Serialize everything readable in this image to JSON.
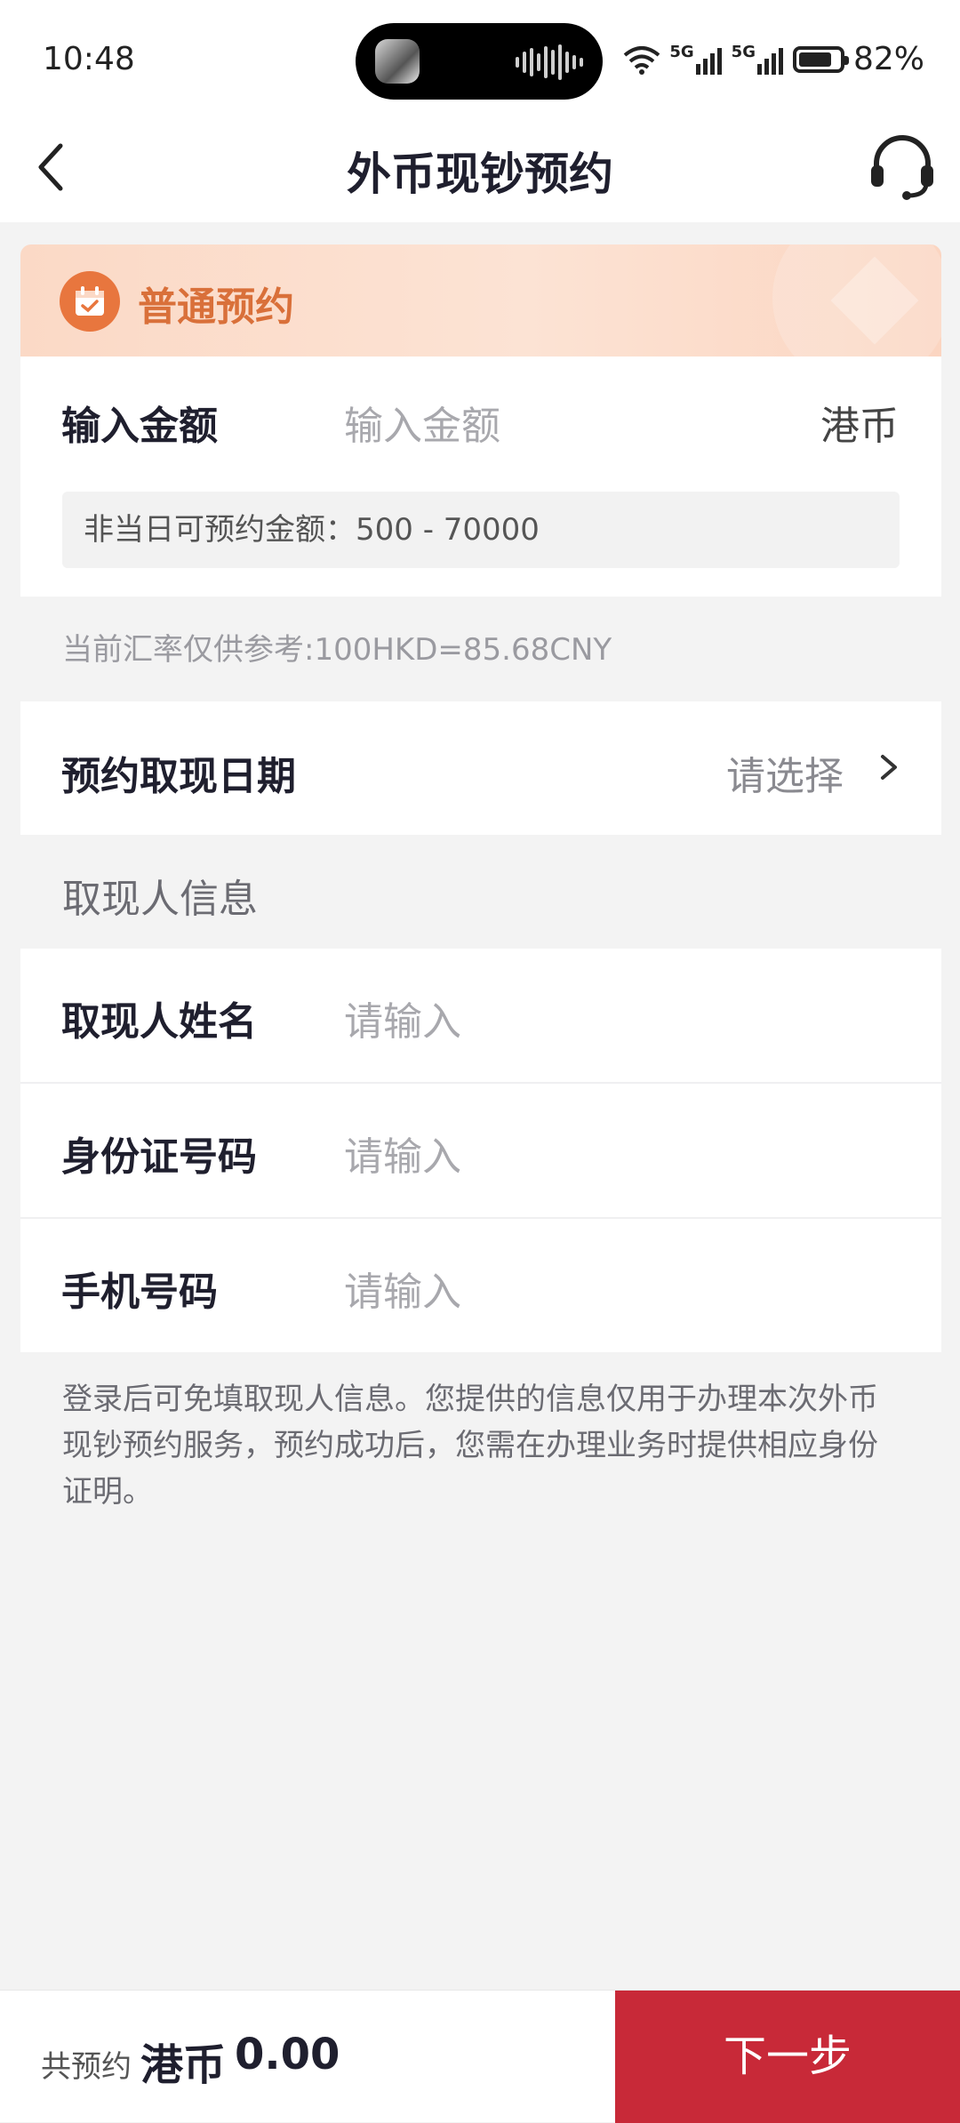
{
  "status_bar": {
    "time": "10:48",
    "network_1": "5G",
    "network_2": "5G",
    "battery_text": "82%",
    "battery_level": 0.82
  },
  "nav": {
    "title": "外币现钞预约",
    "back_icon": "chevron-left-icon",
    "service_icon": "headset-icon"
  },
  "banner": {
    "title": "普通预约",
    "icon": "calendar-check-icon",
    "accent_color": "#e8763e"
  },
  "amount": {
    "label": "输入金额",
    "placeholder": "输入金额",
    "currency": "港币",
    "limit_text": "非当日可预约金额：500 - 70000"
  },
  "rate_note": "当前汇率仅供参考:100HKD=85.68CNY",
  "date_row": {
    "label": "预约取现日期",
    "value": "请选择"
  },
  "section_title": "取现人信息",
  "info_fields": [
    {
      "label": "取现人姓名",
      "placeholder": "请输入"
    },
    {
      "label": "身份证号码",
      "placeholder": "请输入"
    },
    {
      "label": "手机号码",
      "placeholder": "请输入"
    }
  ],
  "disclaimer": "登录后可免填取现人信息。您提供的信息仅用于办理本次外币现钞预约服务，预约成功后，您需在办理业务时提供相应身份证明。",
  "bottom": {
    "total_label": "共预约",
    "total_currency": "港币",
    "total_value": "0.00",
    "next_button": "下一步",
    "button_color": "#c82938"
  }
}
